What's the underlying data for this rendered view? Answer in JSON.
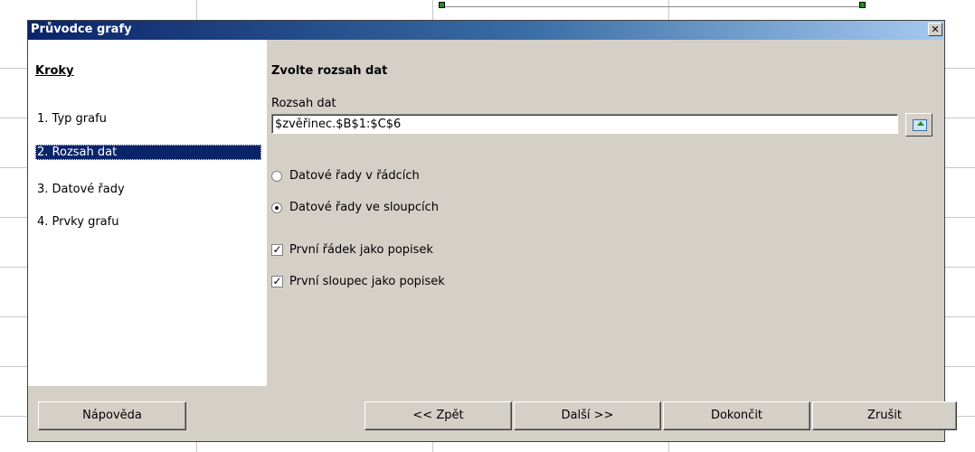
{
  "dialog": {
    "title": "Průvodce grafy",
    "close_symbol": "✕"
  },
  "steps": {
    "heading": "Kroky",
    "items": [
      {
        "label": "1. Typ grafu",
        "selected": false
      },
      {
        "label": "2. Rozsah dat",
        "selected": true
      },
      {
        "label": "3. Datové řady",
        "selected": false
      },
      {
        "label": "4. Prvky grafu",
        "selected": false
      }
    ]
  },
  "content": {
    "title": "Zvolte rozsah dat",
    "range_label": "Rozsah dat",
    "range_value": "$zvěřinec.$B$1:$C$6",
    "shrink_icon": "shrink-dialog-icon",
    "radio_rows": "Datové řady v řádcích",
    "radio_columns": "Datové řady ve sloupcích",
    "radio_selected": "columns",
    "check_first_row": "První řádek jako popisek",
    "check_first_row_checked": true,
    "check_first_col": "První sloupec jako popisek",
    "check_first_col_checked": true
  },
  "buttons": {
    "help": "Nápověda",
    "back": "<< Zpět",
    "next": "Další >>",
    "finish": "Dokončit",
    "cancel": "Zrušit"
  },
  "colors": {
    "titlebar_start": "#0a246a",
    "titlebar_end": "#a6caf0",
    "selection": "#0a246a",
    "dialog_face": "#d4d0c8"
  }
}
